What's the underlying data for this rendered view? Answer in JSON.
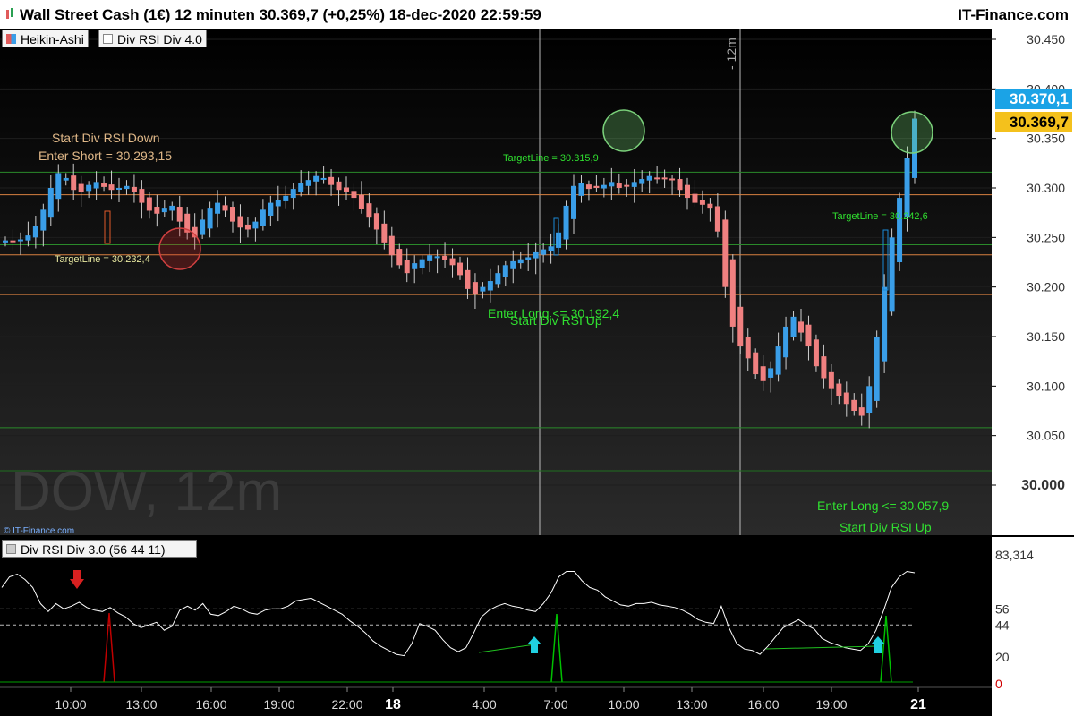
{
  "title": "Wall Street Cash (1€) 12 minuten 30.369,7 (+0,25%) 18-dec-2020 22:59:59",
  "brand": "IT-Finance.com",
  "toolbar": {
    "heikin_label": "Heikin-Ashi",
    "indicator_label": "Div RSI Div 4.0"
  },
  "watermark": "DOW, 12m",
  "copyright": "© IT-Finance.com",
  "period_marker": "- 12m",
  "price_tags": {
    "last_blue": "30.370,1",
    "last_yellow": "30.369,7"
  },
  "colors": {
    "up": "#3a9ee8",
    "down": "#f08080",
    "rsi_line": "#ffffff",
    "signal_green": "#00c800",
    "signal_red": "#c00000",
    "tag_blue": "#1ba3e6",
    "tag_yellow": "#f4c11c"
  },
  "annotations": {
    "start_div_down": "Start Div RSI Down",
    "enter_short": "Enter Short = 30.293,15",
    "target_line_1": "TargetLine = 30.232,4",
    "target_line_2": "TargetLine = 30.315,9",
    "enter_long_1": "Enter Long <= 30.192,4",
    "start_div_up_1": "Start Div RSI Up",
    "target_line_3": "TargetLine = 30.242,6",
    "enter_long_2": "Enter Long <= 30.057,9",
    "start_div_up_2": "Start Div RSI Up"
  },
  "rsi_panel": {
    "label": "Div RSI Div 3.0 (56 44 11)",
    "current_value": "83,314"
  },
  "chart_data": [
    {
      "type": "candlestick",
      "title": "Wall Street Cash (1€) 12 minuten",
      "y_ticks": [
        "30.450",
        "30.400",
        "30.350",
        "30.300",
        "30.250",
        "30.200",
        "30.150",
        "30.100",
        "30.050",
        "30.000"
      ],
      "ylim": [
        29.993,
        30.455
      ],
      "series": [
        {
          "name": "Heikin-Ashi",
          "close": [
            30247,
            30246,
            30248,
            30252,
            30262,
            30278,
            30300,
            30315,
            30310,
            30298,
            30296,
            30303,
            30306,
            30301,
            30298,
            30300,
            30302,
            30296,
            30285,
            30277,
            30274,
            30280,
            30282,
            30266,
            30255,
            30250,
            30268,
            30280,
            30285,
            30277,
            30266,
            30260,
            30258,
            30266,
            30278,
            30285,
            30288,
            30292,
            30299,
            30305,
            30308,
            30312,
            30310,
            30303,
            30298,
            30296,
            30290,
            30279,
            30270,
            30258,
            30245,
            30232,
            30222,
            30214,
            30224,
            30228,
            30232,
            30231,
            30227,
            30222,
            30212,
            30198,
            30193,
            30200,
            30206,
            30214,
            30222,
            30226,
            30228,
            30230,
            30235,
            30238,
            30241,
            30255,
            30282,
            30302,
            30305,
            30299,
            30300,
            30303,
            30306,
            30300,
            30302,
            30306,
            30309,
            30312,
            30309,
            30310,
            30308,
            30298,
            30290,
            30285,
            30283,
            30280,
            30256,
            30200,
            30160,
            30140,
            30128,
            30112,
            30105,
            30118,
            30140,
            30160,
            30170,
            30154,
            30140,
            30120,
            30108,
            30097,
            30090,
            30082,
            30075,
            30070,
            30100,
            30150,
            30200,
            30250,
            30290,
            30330,
            30370
          ]
        }
      ],
      "levels": [
        {
          "name": "TargetLine",
          "value": 30232.4
        },
        {
          "name": "TargetLine",
          "value": 30315.9
        },
        {
          "name": "Enter Long",
          "value": 30192.4
        },
        {
          "name": "TargetLine",
          "value": 30242.6
        },
        {
          "name": "Enter Long",
          "value": 30057.9
        },
        {
          "name": "Enter Short",
          "value": 30293.15
        }
      ],
      "x_ticks": [
        "10:00",
        "13:00",
        "16:00",
        "19:00",
        "22:00",
        "18",
        "4:00",
        "7:00",
        "10:00",
        "13:00",
        "16:00",
        "19:00",
        "21"
      ]
    },
    {
      "type": "line",
      "title": "Div RSI Div 3.0 (56 44 11)",
      "y_ticks": [
        "56",
        "44",
        "20",
        "0"
      ],
      "ylim": [
        0,
        90
      ],
      "levels": [
        56,
        44
      ],
      "series": [
        {
          "name": "Div RSI",
          "values": [
            72,
            80,
            82,
            78,
            72,
            60,
            54,
            60,
            56,
            58,
            61,
            57,
            55,
            54,
            57,
            53,
            50,
            45,
            42,
            44,
            46,
            40,
            43,
            55,
            58,
            55,
            60,
            52,
            51,
            54,
            58,
            56,
            53,
            52,
            55,
            56,
            56,
            58,
            62,
            63,
            64,
            61,
            58,
            55,
            52,
            47,
            43,
            38,
            32,
            28,
            25,
            22,
            21,
            30,
            45,
            43,
            40,
            33,
            27,
            24,
            27,
            38,
            50,
            55,
            58,
            60,
            58,
            57,
            55,
            54,
            60,
            68,
            80,
            84,
            84,
            77,
            72,
            70,
            65,
            62,
            59,
            58,
            60,
            60,
            61,
            59,
            58,
            57,
            55,
            52,
            48,
            46,
            45,
            58,
            42,
            30,
            26,
            25,
            22,
            28,
            35,
            42,
            45,
            48,
            44,
            41,
            34,
            31,
            29,
            27,
            26,
            25,
            30,
            40,
            55,
            72,
            80,
            84,
            83
          ]
        }
      ]
    }
  ]
}
